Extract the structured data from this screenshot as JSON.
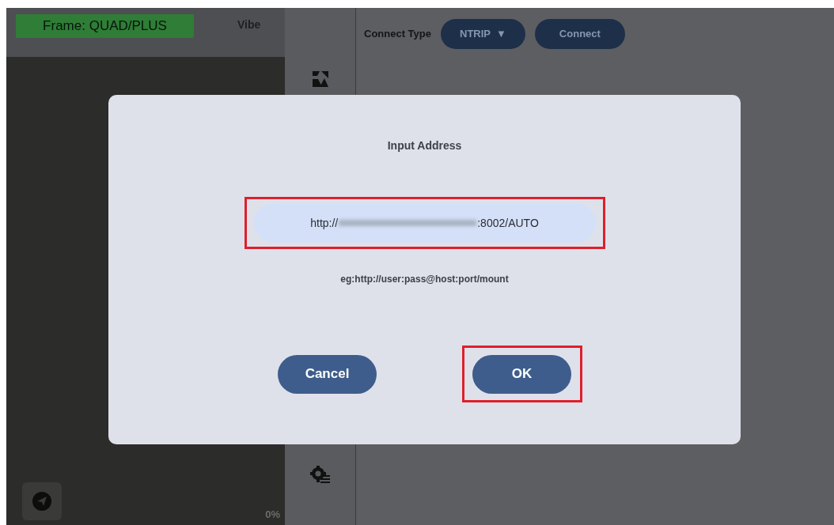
{
  "top_bar": {
    "frame_label": "Frame: QUAD/PLUS",
    "vibe_label": "Vibe"
  },
  "progress_label": "0%",
  "connect": {
    "label": "Connect Type",
    "type_value": "NTRIP",
    "type_caret": "▼",
    "connect_button": "Connect"
  },
  "dialog": {
    "title": "Input Address",
    "address_prefix": "http://",
    "address_suffix": ":8002/AUTO",
    "address_highlighted": true,
    "hint": "eg:http://user:pass@host:port/mount",
    "buttons": [
      {
        "label": "Cancel",
        "highlighted": false
      },
      {
        "label": "OK",
        "highlighted": true
      }
    ]
  }
}
